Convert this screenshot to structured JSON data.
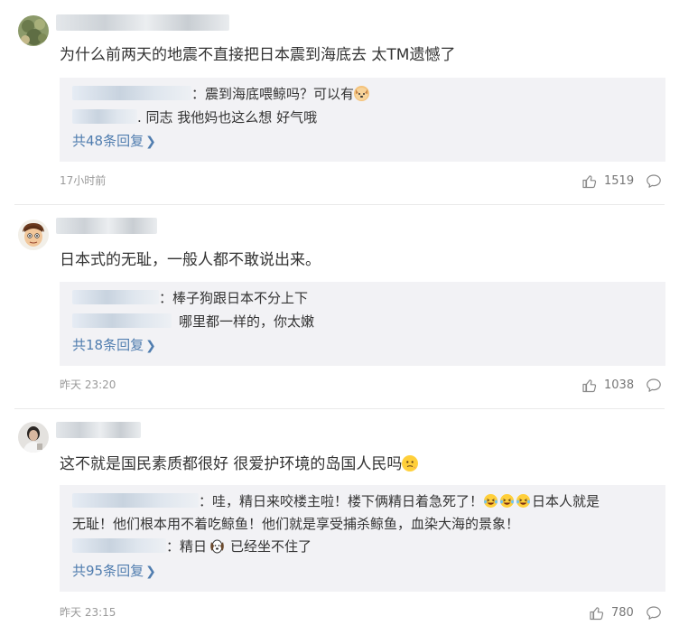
{
  "comments": [
    {
      "text": "为什么前两天的地震不直接把日本震到海底去 太TM遗憾了",
      "replies": [
        {
          "text": "：震到海底喂鲸吗？可以有"
        },
        {
          "text": ". 同志 我他妈也这么想 好气哦"
        }
      ],
      "more_label": "共48条回复",
      "time": "17小时前",
      "likes": "1519"
    },
    {
      "text": "日本式的无耻，一般人都不敢说出来。",
      "replies": [
        {
          "text": "：棒子狗跟日本不分上下"
        },
        {
          "text": "哪里都一样的，你太嫩"
        }
      ],
      "more_label": "共18条回复",
      "time": "昨天 23:20",
      "likes": "1038"
    },
    {
      "text": "这不就是国民素质都很好 很爱护环境的岛国人民吗",
      "replies": [
        {
          "text_a": "：哇，精日来咬楼主啦！楼下俩精日着急死了！",
          "text_b": "日本人就是",
          "text_c": "无耻！他们根本用不着吃鲸鱼！他们就是享受捕杀鲸鱼，血染大海的景象！"
        },
        {
          "text_a": "：精日",
          "text_b": "已经坐不住了"
        }
      ],
      "more_label": "共95条回复",
      "time": "昨天 23:15",
      "likes": "780"
    }
  ],
  "icons": {
    "like": "thumbs-up-icon",
    "comment": "speech-bubble-icon",
    "more": "chevron-right-icon"
  },
  "colors": {
    "link": "#507daf",
    "reply_bg": "#f2f2f5",
    "meta": "#999999"
  }
}
